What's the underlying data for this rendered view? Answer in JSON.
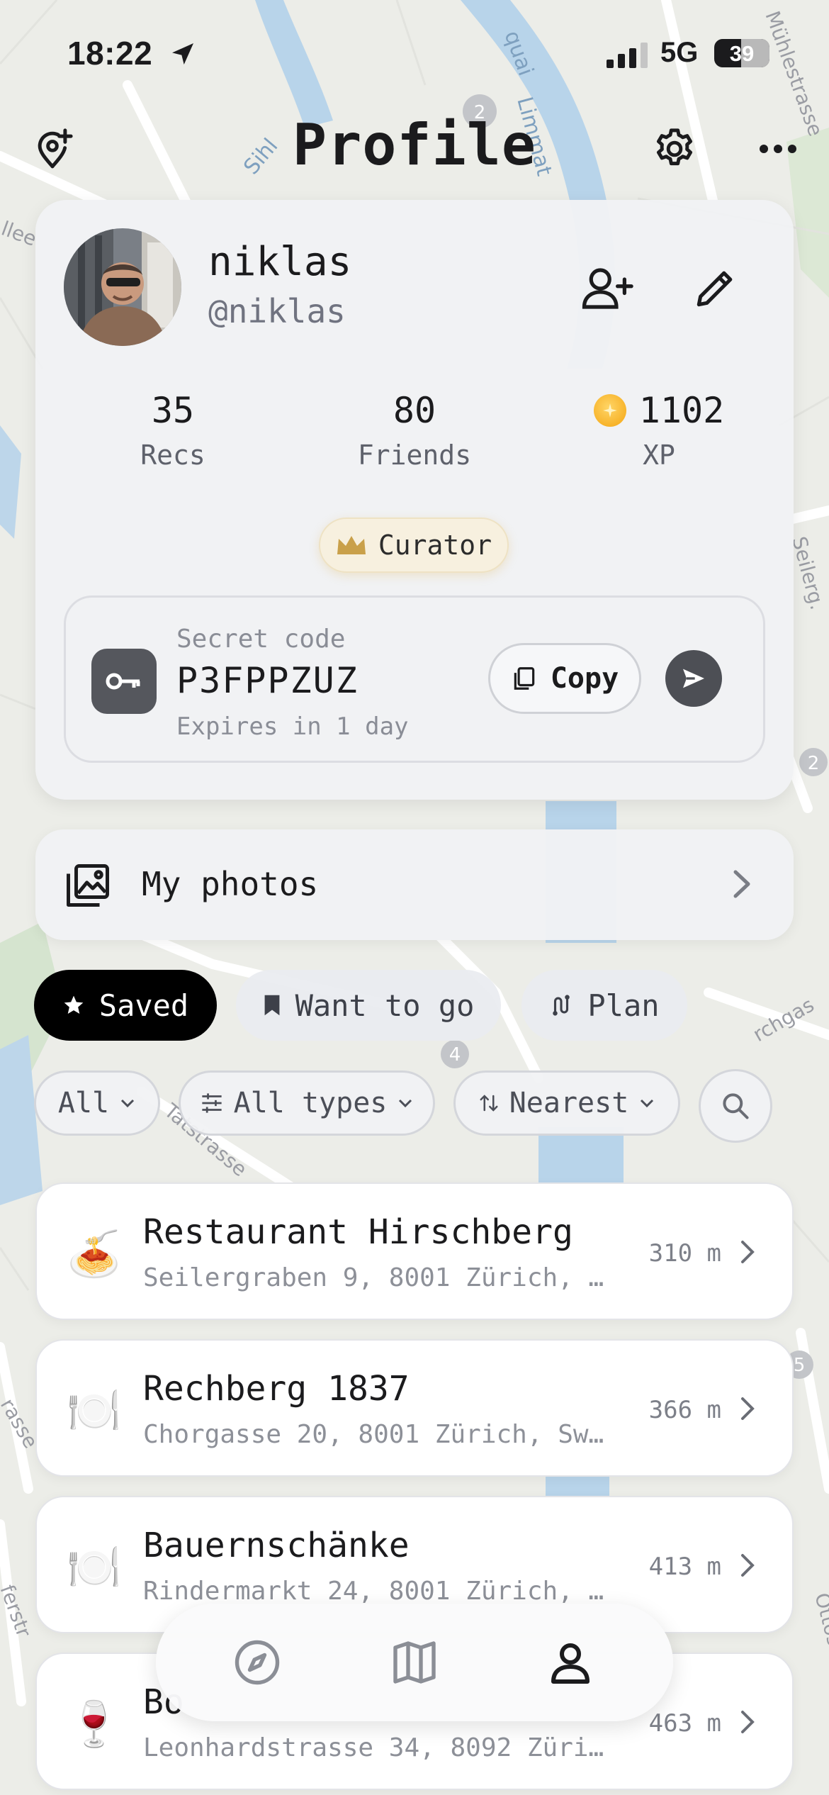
{
  "status_bar": {
    "time": "18:22",
    "network": "5G",
    "battery": "39"
  },
  "header": {
    "title": "Profile",
    "icons": {
      "left": "add-location-icon",
      "settings": "gear-icon",
      "more": "more-dots-icon"
    }
  },
  "profile": {
    "name": "niklas",
    "handle": "@niklas",
    "stats": [
      {
        "value": "35",
        "label": "Recs"
      },
      {
        "value": "80",
        "label": "Friends"
      },
      {
        "value": "1102",
        "label": "XP"
      }
    ],
    "badge": "Curator",
    "secret": {
      "label": "Secret code",
      "code": "P3FPPZUZ",
      "expires": "Expires in 1 day",
      "copy_label": "Copy"
    }
  },
  "photos": {
    "label": "My photos"
  },
  "tabs": [
    {
      "label": "Saved",
      "icon": "star-icon",
      "active": true
    },
    {
      "label": "Want to go",
      "icon": "bookmark-icon",
      "active": false
    },
    {
      "label": "Plan",
      "icon": "route-icon",
      "active": false
    }
  ],
  "filters": [
    {
      "label": "All",
      "icon": ""
    },
    {
      "label": "All types",
      "icon": "sliders-icon"
    },
    {
      "label": "Nearest",
      "icon": "sort-icon"
    }
  ],
  "places": [
    {
      "emoji": "🍝",
      "name": "Restaurant Hirschberg",
      "address": "Seilergraben 9, 8001 Zürich, …",
      "distance": "310 m"
    },
    {
      "emoji": "🍽️",
      "name": "Rechberg 1837",
      "address": "Chorgasse 20, 8001 Zürich, Sw…",
      "distance": "366 m"
    },
    {
      "emoji": "🍽️",
      "name": "Bauernschänke",
      "address": "Rindermarkt 24, 8001 Zürich, …",
      "distance": "413 m"
    },
    {
      "emoji": "🍷",
      "name": "Bo",
      "address": "Leonhardstrasse 34, 8092 Züri…",
      "distance": "463 m"
    }
  ],
  "bottom_nav": [
    {
      "name": "explore",
      "icon": "compass-icon",
      "active": false
    },
    {
      "name": "map",
      "icon": "map-icon",
      "active": false
    },
    {
      "name": "profile",
      "icon": "person-icon",
      "active": true
    }
  ],
  "colors": {
    "accent": "#000000",
    "coin": "#f4a511",
    "badge_bg": "#f7f0df",
    "crown": "#c9a04a"
  }
}
